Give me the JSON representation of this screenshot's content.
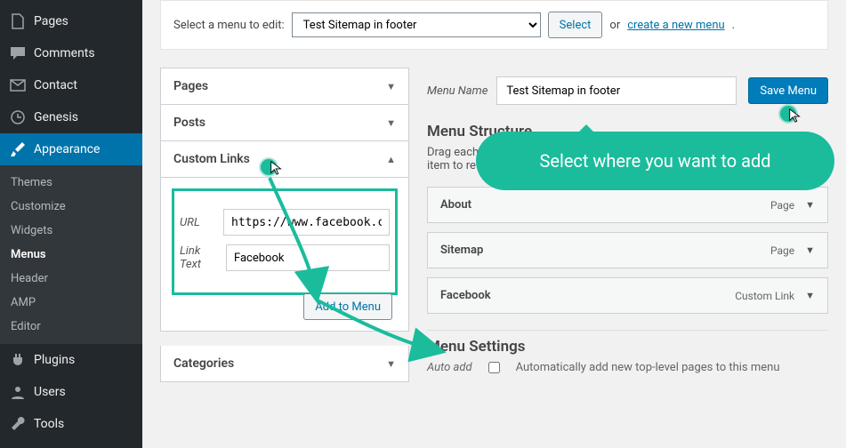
{
  "sidebar": {
    "items": [
      {
        "label": "Pages",
        "icon": "page"
      },
      {
        "label": "Comments",
        "icon": "comment"
      },
      {
        "label": "Contact",
        "icon": "mail"
      },
      {
        "label": "Genesis",
        "icon": "genesis"
      },
      {
        "label": "Appearance",
        "icon": "brush",
        "active": true
      },
      {
        "label": "Plugins",
        "icon": "plug"
      },
      {
        "label": "Users",
        "icon": "user"
      },
      {
        "label": "Tools",
        "icon": "wrench"
      }
    ],
    "sub": [
      {
        "label": "Themes"
      },
      {
        "label": "Customize"
      },
      {
        "label": "Widgets"
      },
      {
        "label": "Menus",
        "current": true
      },
      {
        "label": "Header"
      },
      {
        "label": "AMP"
      },
      {
        "label": "Editor"
      }
    ]
  },
  "picker": {
    "label": "Select a menu to edit:",
    "options": [
      "Test Sitemap in footer"
    ],
    "selected": "Test Sitemap in footer",
    "select_btn": "Select",
    "or": "or",
    "create_link": "create a new menu"
  },
  "accordion": {
    "pages": "Pages",
    "posts": "Posts",
    "custom": "Custom Links",
    "categories": "Categories"
  },
  "custom": {
    "url_label": "URL",
    "url_value": "https://www.facebook.c",
    "text_label": "Link Text",
    "text_value": "Facebook",
    "add_btn": "Add to Menu"
  },
  "menu": {
    "name_label": "Menu Name",
    "name_value": "Test Sitemap in footer",
    "save_btn": "Save Menu",
    "struct_heading": "Menu Structure",
    "struct_desc": "Drag each item into the order you prefer. Click the arrow on the right of the item to reveal additional configuration options.",
    "items": [
      {
        "label": "About",
        "type": "Page"
      },
      {
        "label": "Sitemap",
        "type": "Page"
      },
      {
        "label": "Facebook",
        "type": "Custom Link"
      }
    ],
    "settings_heading": "Menu Settings",
    "auto_add": "Auto add",
    "auto_add_desc": "Automatically add new top-level pages to this menu"
  },
  "callout": "Select where you want to add"
}
